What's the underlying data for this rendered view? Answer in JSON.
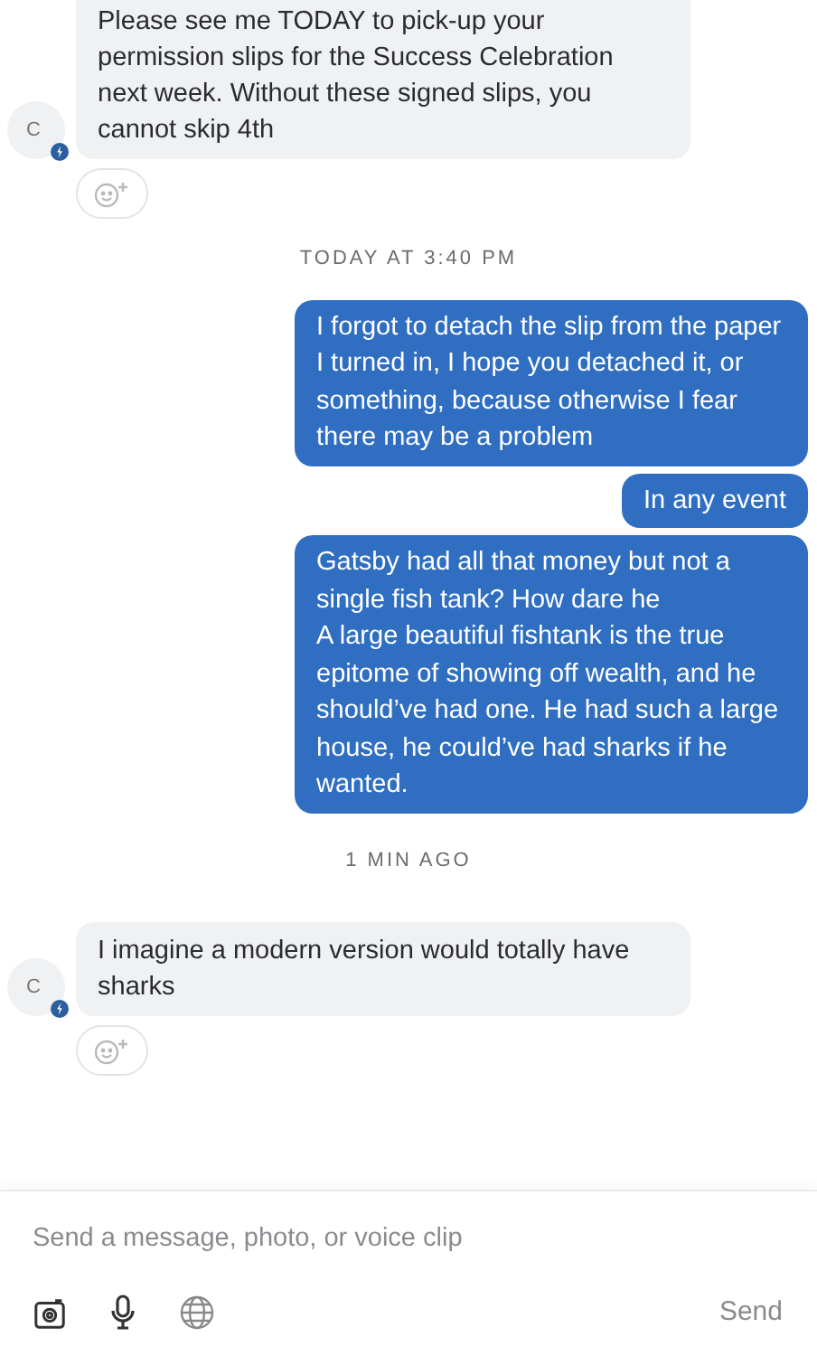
{
  "messages": [
    {
      "kind": "received",
      "avatar": "C",
      "lines": [
        "Please see me TODAY to pick-up your permission slips for the Success Celebration next week. Without these signed slips, you cannot skip 4th"
      ]
    },
    {
      "kind": "timestamp",
      "text": "TODAY AT 3:40 PM"
    },
    {
      "kind": "sent",
      "lines": [
        "I forgot to detach the slip from the paper I turned in, I hope you detached it, or something, because otherwise I fear there may be a problem"
      ]
    },
    {
      "kind": "sent",
      "lines": [
        "In any event"
      ]
    },
    {
      "kind": "sent",
      "lines": [
        "Gatsby had all that money but not a single fish tank? How dare he",
        "A large beautiful fishtank is the true epitome of showing off wealth, and he should’ve had one. He had such a large house, he could’ve had sharks if he wanted."
      ]
    },
    {
      "kind": "timestamp",
      "text": "1 MIN AGO"
    },
    {
      "kind": "received",
      "avatar": "C",
      "lines": [
        "I imagine a modern version would totally have sharks"
      ]
    }
  ],
  "composer": {
    "placeholder": "Send a message, photo, or voice clip",
    "send": "Send"
  }
}
